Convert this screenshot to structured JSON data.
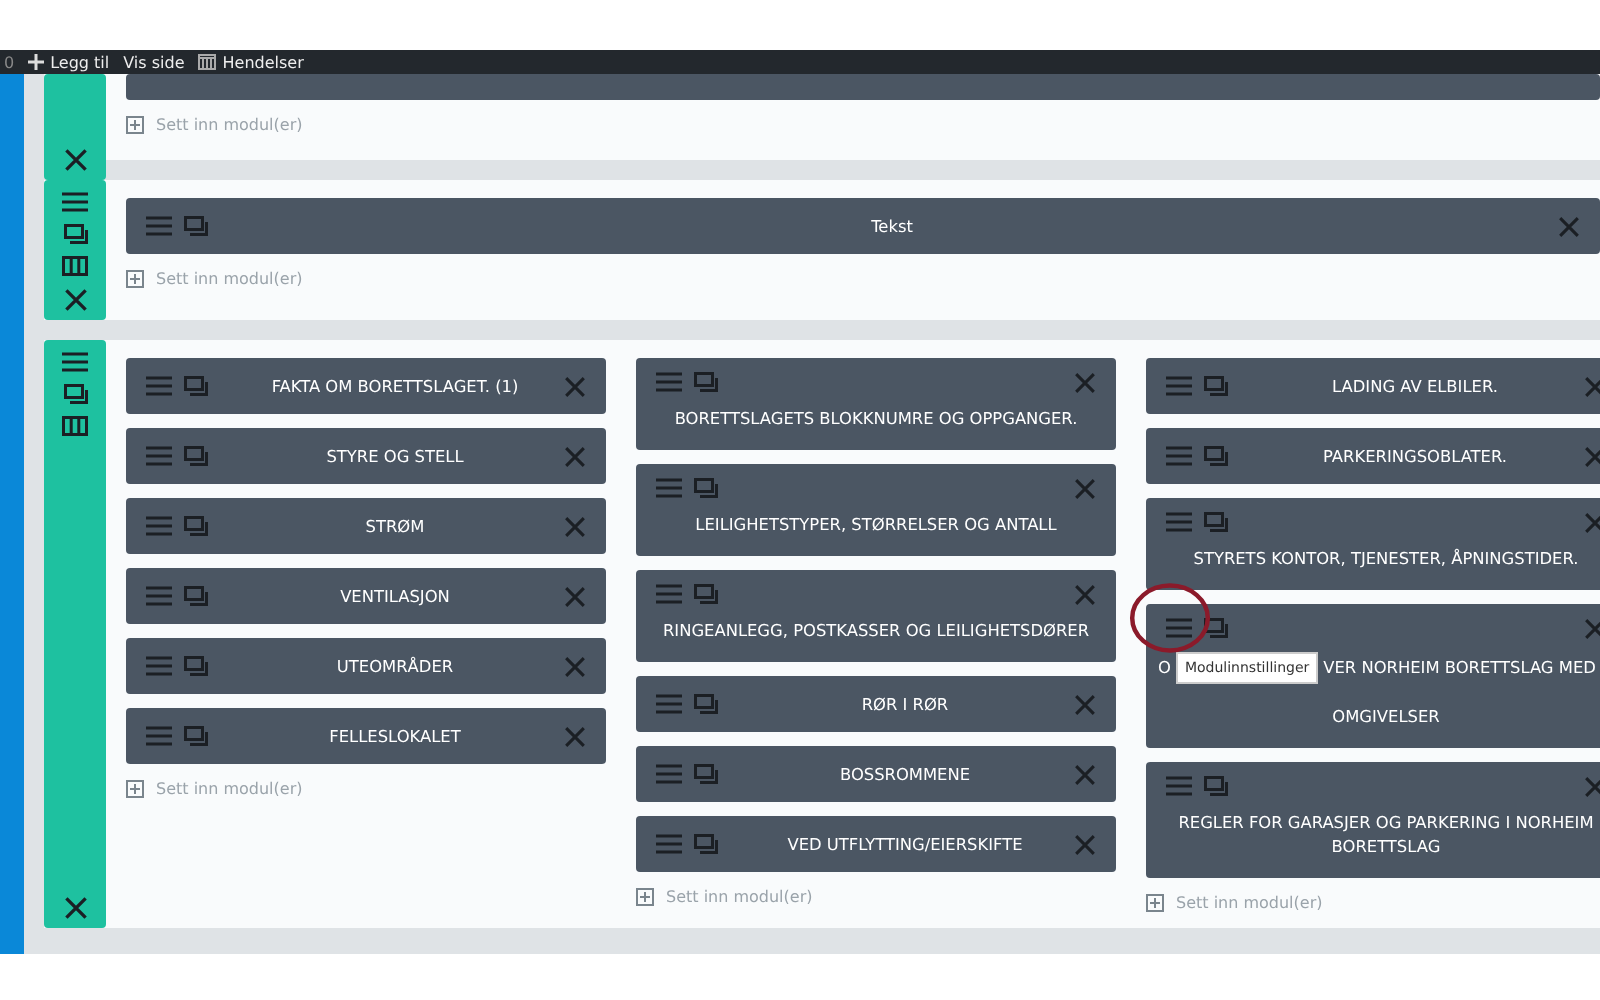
{
  "admin_bar": {
    "counter": "0",
    "items": [
      {
        "kind": "add",
        "label": "Legg til"
      },
      {
        "kind": "plain",
        "label": "Vis side"
      },
      {
        "kind": "calendar",
        "label": "Hendelser"
      }
    ]
  },
  "sections": [
    {
      "footer_controls": [
        {
          "kind": "close"
        }
      ],
      "columns": [
        {
          "modules": [
            {
              "kind": "clipped"
            }
          ],
          "insert": "Sett inn modul(er)"
        }
      ]
    },
    {
      "controls": [
        {
          "kind": "menu"
        },
        {
          "kind": "duplicate"
        },
        {
          "kind": "columns"
        },
        {
          "kind": "close"
        }
      ],
      "columns": [
        {
          "modules": [
            {
              "kind": "single",
              "title": "Tekst"
            }
          ],
          "insert": "Sett inn modul(er)"
        }
      ]
    },
    {
      "controls": [
        {
          "kind": "menu"
        },
        {
          "kind": "duplicate"
        },
        {
          "kind": "columns"
        }
      ],
      "footer_controls": [
        {
          "kind": "close"
        }
      ],
      "columns": [
        {
          "modules": [
            {
              "kind": "single",
              "title": "FAKTA OM BORETTSLAGET. (1)"
            },
            {
              "kind": "single",
              "title": "STYRE OG STELL"
            },
            {
              "kind": "single",
              "title": "STRØM"
            },
            {
              "kind": "single",
              "title": "VENTILASJON"
            },
            {
              "kind": "single",
              "title": "UTEOMRÅDER"
            },
            {
              "kind": "single",
              "title": "FELLESLOKALET"
            }
          ],
          "insert": "Sett inn modul(er)"
        },
        {
          "modules": [
            {
              "kind": "wrapped",
              "title": "BORETTSLAGETS BLOKKNUMRE OG OPPGANGER."
            },
            {
              "kind": "wrapped",
              "title": "LEILIGHETSTYPER, STØRRELSER OG ANTALL"
            },
            {
              "kind": "wrapped",
              "title": "RINGEANLEGG, POSTKASSER OG LEILIGHETSDØRER"
            },
            {
              "kind": "single",
              "title": "RØR I RØR"
            },
            {
              "kind": "single",
              "title": "BOSSROMMENE"
            },
            {
              "kind": "single",
              "title": "VED UTFLYTTING/EIERSKIFTE"
            }
          ],
          "insert": "Sett inn modul(er)"
        },
        {
          "modules": [
            {
              "kind": "single",
              "title": "LADING AV ELBILER."
            },
            {
              "kind": "single",
              "title": "PARKERINGSOBLATER."
            },
            {
              "kind": "wrapped",
              "title": "STYRETS KONTOR, TJENESTER, ÅPNINGSTIDER."
            },
            {
              "kind": "tooltip",
              "prefix": "O",
              "tooltip": "Modulinnstillinger",
              "title": "VER NORHEIM BORETTSLAG MED",
              "title_line2": "OMGIVELSER",
              "circled": true
            },
            {
              "kind": "wrapped",
              "title": "REGLER FOR GARASJER OG PARKERING I NORHEIM BORETTSLAG"
            }
          ],
          "insert": "Sett inn modul(er)"
        }
      ]
    }
  ]
}
